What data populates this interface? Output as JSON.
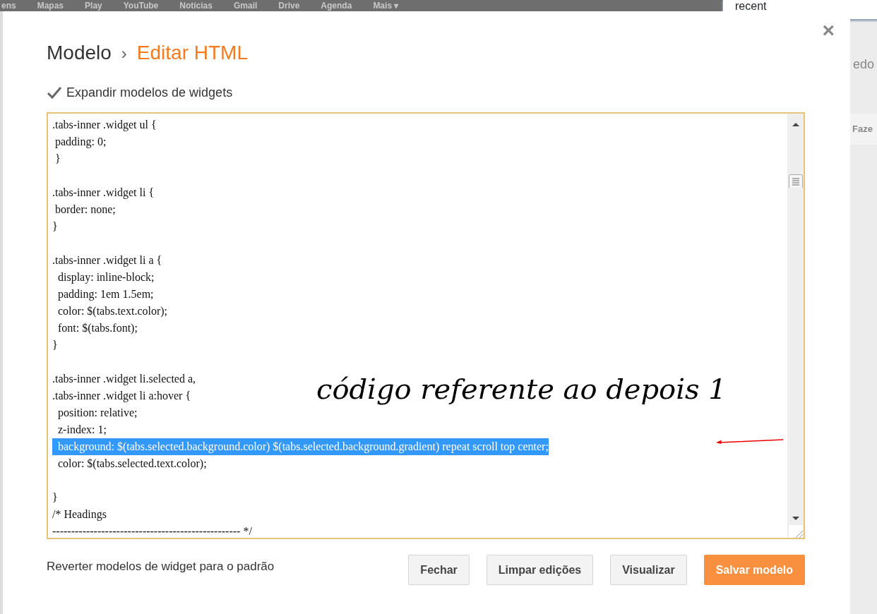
{
  "top_bar": {
    "links": [
      "ens",
      "Mapas",
      "Play",
      "YouTube",
      "Notícias",
      "Gmail",
      "Drive",
      "Agenda",
      "Mais ▾"
    ]
  },
  "search": {
    "value": "recent"
  },
  "background_texts": [
    "edo",
    "Faze"
  ],
  "dialog": {
    "breadcrumb": {
      "parent": "Modelo",
      "separator": "›",
      "current": "Editar HTML"
    },
    "close": "×",
    "expand_option": {
      "label": "Expandir modelos de widgets",
      "checked": true
    },
    "code_blocks": [
      {
        "lines": [
          {
            "text": ".tabs-inner .widget ul {",
            "selected": false
          },
          {
            "text": " padding: 0;",
            "selected": false
          },
          {
            "text": " }",
            "selected": false
          }
        ]
      },
      {
        "lines": [
          {
            "text": ".tabs-inner .widget li {",
            "selected": false
          },
          {
            "text": " border: none;",
            "selected": false
          },
          {
            "text": "}",
            "selected": false
          }
        ]
      },
      {
        "lines": [
          {
            "text": ".tabs-inner .widget li a {",
            "selected": false
          },
          {
            "text": "  display: inline-block;",
            "selected": false
          },
          {
            "text": "  padding: 1em 1.5em;",
            "selected": false
          },
          {
            "text": "  color: $(tabs.text.color);",
            "selected": false
          },
          {
            "text": "  font: $(tabs.font);",
            "selected": false
          },
          {
            "text": "}",
            "selected": false
          }
        ]
      },
      {
        "lines": [
          {
            "text": ".tabs-inner .widget li.selected a,",
            "selected": false
          },
          {
            "text": ".tabs-inner .widget li a:hover {",
            "selected": false
          },
          {
            "text": "  position: relative;",
            "selected": false
          },
          {
            "text": "  z-index: 1;",
            "selected": false
          },
          {
            "text": "  background: $(tabs.selected.background.color) $(tabs.selected.background.gradient) repeat scroll top center;",
            "selected": true
          },
          {
            "text": "  color: $(tabs.selected.text.color);",
            "selected": false
          }
        ]
      },
      {
        "lines": [
          {
            "text": "}",
            "selected": false
          },
          {
            "text": "/* Headings",
            "selected": false
          },
          {
            "text": "-------------------------------------------------- */",
            "selected": false
          }
        ]
      }
    ],
    "annotation": "código referente ao depois 1",
    "revert_link": "Reverter modelos de widget para o padrão",
    "buttons": [
      {
        "label": "Fechar",
        "kind": "default"
      },
      {
        "label": "Limpar edições",
        "kind": "default"
      },
      {
        "label": "Visualizar",
        "kind": "default"
      },
      {
        "label": "Salvar modelo",
        "kind": "primary"
      }
    ]
  }
}
